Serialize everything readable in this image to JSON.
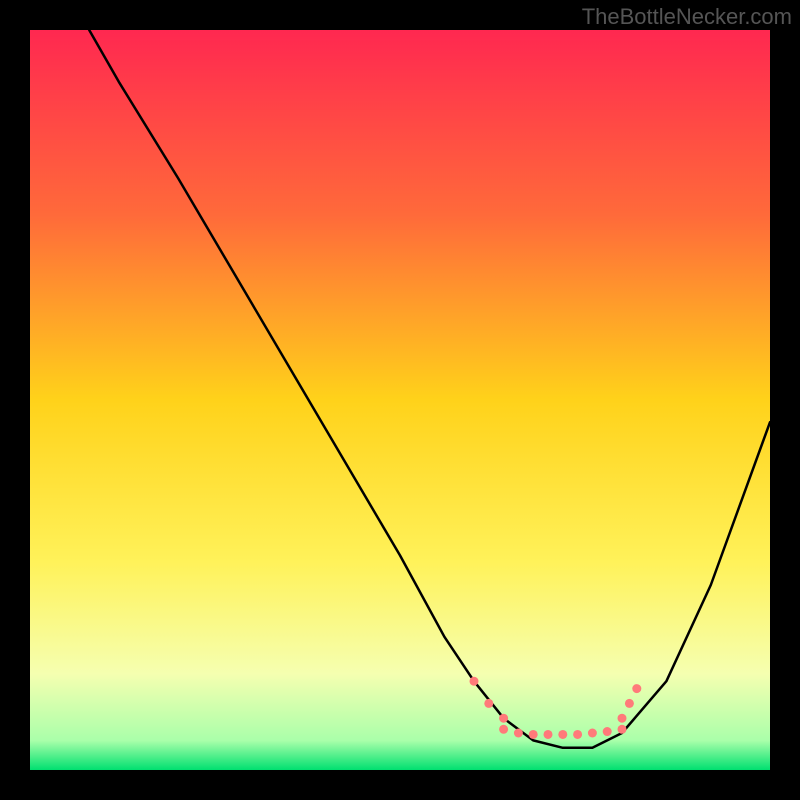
{
  "watermark": "TheBottleNecker.com",
  "chart_data": {
    "type": "line",
    "title": "",
    "xlabel": "",
    "ylabel": "",
    "xlim": [
      0,
      100
    ],
    "ylim": [
      0,
      100
    ],
    "gradient_stops": [
      {
        "offset": 0,
        "color": "#ff2850"
      },
      {
        "offset": 25,
        "color": "#ff6a3a"
      },
      {
        "offset": 50,
        "color": "#ffd21a"
      },
      {
        "offset": 72,
        "color": "#fff25a"
      },
      {
        "offset": 87,
        "color": "#f5ffb0"
      },
      {
        "offset": 96,
        "color": "#aaffaa"
      },
      {
        "offset": 100,
        "color": "#00e070"
      }
    ],
    "curve": {
      "x": [
        8,
        12,
        20,
        30,
        40,
        50,
        56,
        60,
        64,
        68,
        72,
        76,
        80,
        86,
        92,
        100
      ],
      "y": [
        100,
        93,
        80,
        63,
        46,
        29,
        18,
        12,
        7,
        4,
        3,
        3,
        5,
        12,
        25,
        47
      ]
    },
    "dotted_segments": [
      {
        "x": [
          60,
          62,
          64
        ],
        "y": [
          12,
          9,
          7
        ]
      },
      {
        "x": [
          64,
          66,
          68,
          70,
          72,
          74,
          76,
          78,
          80
        ],
        "y": [
          5.5,
          5,
          4.8,
          4.8,
          4.8,
          4.8,
          5,
          5.2,
          5.5
        ]
      },
      {
        "x": [
          80,
          81,
          82
        ],
        "y": [
          7,
          9,
          11
        ]
      }
    ],
    "dotted_color": "#ff7a7a"
  }
}
